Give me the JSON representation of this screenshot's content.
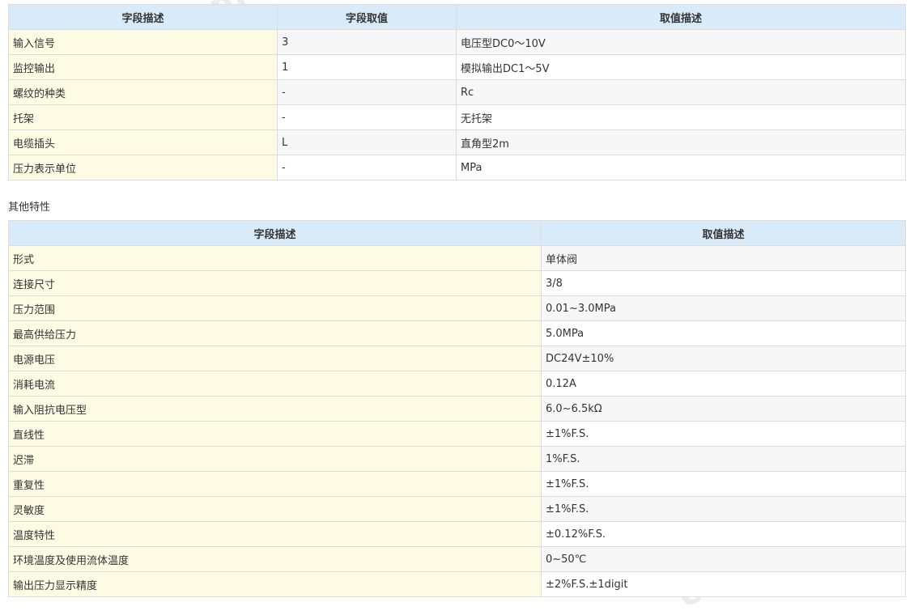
{
  "table1": {
    "headers": [
      "字段描述",
      "字段取值",
      "取值描述"
    ],
    "rows": [
      [
        "输入信号",
        "3",
        "电压型DC0～10V"
      ],
      [
        "监控输出",
        "1",
        "模拟输出DC1～5V"
      ],
      [
        "螺纹的种类",
        "-",
        "Rc"
      ],
      [
        "托架",
        "-",
        "无托架"
      ],
      [
        "电缆插头",
        "L",
        "直角型2m"
      ],
      [
        "压力表示单位",
        "-",
        "MPa"
      ]
    ]
  },
  "section_label": "其他特性",
  "table2": {
    "headers": [
      "字段描述",
      "取值描述"
    ],
    "rows": [
      [
        "形式",
        "单体阀"
      ],
      [
        "连接尺寸",
        "3/8"
      ],
      [
        "压力范围",
        "0.01~3.0MPa"
      ],
      [
        "最高供给压力",
        "5.0MPa"
      ],
      [
        "电源电压",
        "DC24V±10%"
      ],
      [
        "消耗电流",
        "0.12A"
      ],
      [
        "输入阻抗电压型",
        "6.0~6.5kΩ"
      ],
      [
        "直线性",
        "±1%F.S."
      ],
      [
        "迟滞",
        "1%F.S."
      ],
      [
        "重复性",
        "±1%F.S."
      ],
      [
        "灵敏度",
        "±1%F.S."
      ],
      [
        "温度特性",
        "±0.12%F.S."
      ],
      [
        "环境温度及使用流体温度",
        "0~50℃"
      ],
      [
        "输出压力显示精度",
        "±2%F.S.±1digit"
      ]
    ]
  },
  "watermark": "chem17.com",
  "colors": {
    "header_bg": "#d9ebf9",
    "desc_bg": "#fdfbe3",
    "alt_row_bg": "#f7f7f7",
    "border": "#dcdcdc"
  }
}
